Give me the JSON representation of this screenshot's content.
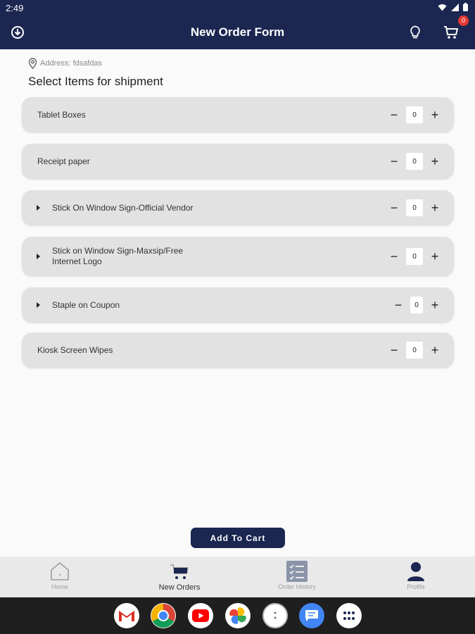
{
  "status_bar": {
    "time": "2:49"
  },
  "app_bar": {
    "title": "New Order Form",
    "cart_count": "0"
  },
  "address": {
    "text": "Address: fdsafdas"
  },
  "section": {
    "title": "Select Items for shipment"
  },
  "items": [
    {
      "line1": "Tablet Boxes",
      "line2": "",
      "qty": "0",
      "expandable": false
    },
    {
      "line1": "Receipt paper",
      "line2": "",
      "qty": "0",
      "expandable": false
    },
    {
      "line1": "Stick On Window Sign-Official Vendor",
      "line2": "",
      "qty": "0",
      "expandable": true
    },
    {
      "line1": "Stick on Window Sign-Maxsip/Free",
      "line2": "Internet Logo",
      "qty": "0",
      "expandable": true
    },
    {
      "line1": "Staple on Coupon",
      "line2": "",
      "qty": "0",
      "expandable": true
    },
    {
      "line1": "Kiosk Screen Wipes",
      "line2": "",
      "qty": "0",
      "expandable": false
    }
  ],
  "actions": {
    "add_to_cart": "Add To Cart"
  },
  "bottom_nav": [
    {
      "label": "Home",
      "icon": "home-icon",
      "active": false
    },
    {
      "label": "New Orders",
      "icon": "cart-icon",
      "active": true
    },
    {
      "label": "Order History",
      "icon": "checklist-icon",
      "active": false
    },
    {
      "label": "Profile",
      "icon": "person-icon",
      "active": false
    }
  ],
  "dock_apps": [
    "gmail-icon",
    "chrome-icon",
    "youtube-icon",
    "photos-icon",
    "assistant-icon",
    "messages-icon",
    "app-drawer-icon"
  ],
  "colors": {
    "primary": "#1b2651",
    "badge": "#e53935",
    "row_bg": "#e2e2e2",
    "nav_bg": "#e9e9e9"
  }
}
